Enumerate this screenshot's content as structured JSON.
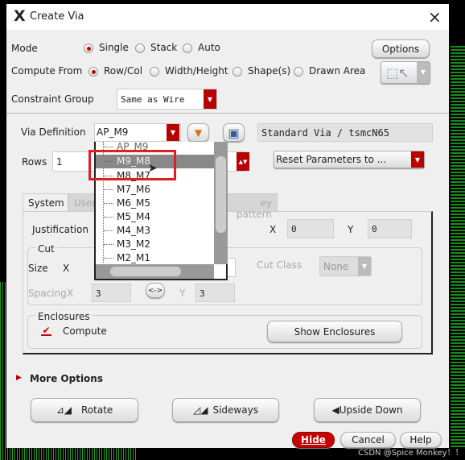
{
  "window": {
    "title": "Create Via",
    "close": "×"
  },
  "mode": {
    "label": "Mode",
    "options": [
      "Single",
      "Stack",
      "Auto"
    ],
    "selected": "Single",
    "options_button": "Options"
  },
  "compute_from": {
    "label": "Compute From",
    "options": [
      "Row/Col",
      "Width/Height",
      "Shape(s)",
      "Drawn Area"
    ],
    "selected": "Row/Col"
  },
  "constraint_group": {
    "label": "Constraint Group",
    "value": "Same as Wire"
  },
  "via_definition": {
    "label": "Via Definition",
    "value": "AP_M9",
    "info": "Standard Via / tsmcN65",
    "dropdown_items": [
      "AP_M9",
      "M9_M8",
      "M8_M7",
      "M7_M6",
      "M6_M5",
      "M5_M4",
      "M4_M3",
      "M3_M2",
      "M2_M1"
    ],
    "highlighted": "M9_M8"
  },
  "rows": {
    "label": "Rows",
    "value": "1"
  },
  "reset": {
    "value": "Reset Parameters to ..."
  },
  "tabs": [
    "System",
    "User",
    "ey pattern"
  ],
  "justification": {
    "label": "Justification",
    "x_label": "X",
    "x": "0",
    "y_label": "Y",
    "y": "0"
  },
  "cut": {
    "title": "Cut",
    "size_label": "Size",
    "x_label": "X",
    "cut_class_label": "Cut Class",
    "cut_class": "None",
    "spacing_label": "Spacing",
    "spacing_x_label": "X",
    "spacing_x": "3",
    "swap": "<->",
    "spacing_y_label": "Y",
    "spacing_y": "3"
  },
  "enclosures": {
    "title": "Enclosures",
    "compute_label": "Compute",
    "compute_checked": true,
    "show_button": "Show Enclosures"
  },
  "more_options": "More Options",
  "actions": {
    "rotate": "Rotate",
    "sideways": "Sideways",
    "upside_down": "Upside Down"
  },
  "footer": {
    "hide": "Hide",
    "cancel": "Cancel",
    "help": "Help"
  },
  "watermark": "CSDN @Spice Monkey！！",
  "colors": {
    "accent": "#b80000",
    "highlight": "#888888",
    "callout": "#e02020"
  }
}
